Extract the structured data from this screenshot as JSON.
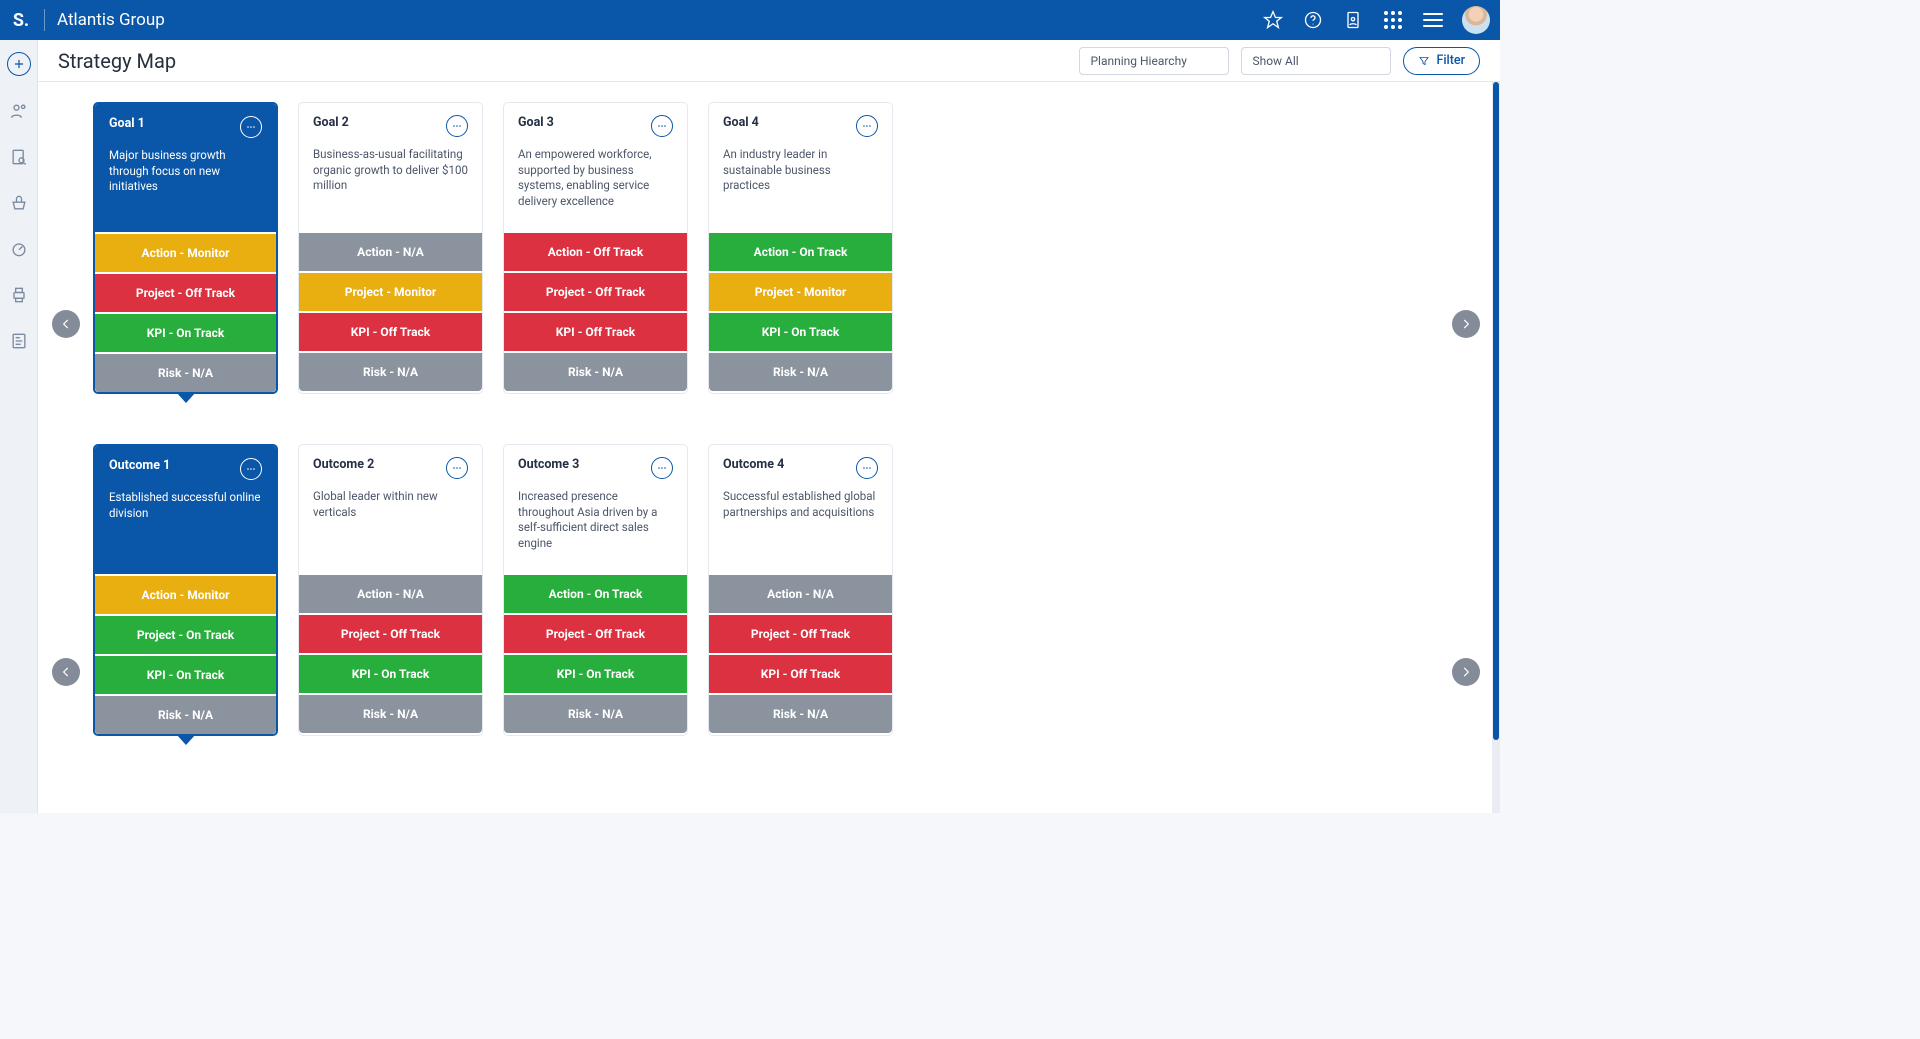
{
  "brand": {
    "logo": "S.",
    "name": "Atlantis Group"
  },
  "page": {
    "title": "Strategy Map"
  },
  "filters": {
    "planning_placeholder": "Planning Hiearchy",
    "show_placeholder": "Show All",
    "filter_label": "Filter"
  },
  "status_colors": {
    "na": "#8b939f",
    "off_track": "#db3140",
    "on_track": "#27ae3d",
    "monitor": "#e9ae10"
  },
  "rows": [
    {
      "key": "goals",
      "cards": [
        {
          "selected": true,
          "title": "Goal 1",
          "desc": "Major business growth through focus on new initiatives",
          "stats": [
            {
              "label": "Action - Monitor",
              "color": "yellow"
            },
            {
              "label": "Project - Off Track",
              "color": "red"
            },
            {
              "label": "KPI - On Track",
              "color": "green"
            },
            {
              "label": "Risk - N/A",
              "color": "gray"
            }
          ]
        },
        {
          "selected": false,
          "title": "Goal 2",
          "desc": "Business-as-usual facilitating organic growth to deliver $100 million",
          "stats": [
            {
              "label": "Action - N/A",
              "color": "gray"
            },
            {
              "label": "Project - Monitor",
              "color": "yellow"
            },
            {
              "label": "KPI - Off Track",
              "color": "red"
            },
            {
              "label": "Risk - N/A",
              "color": "gray"
            }
          ]
        },
        {
          "selected": false,
          "title": "Goal 3",
          "desc": "An empowered workforce, supported by business systems, enabling service delivery excellence",
          "stats": [
            {
              "label": "Action - Off Track",
              "color": "red"
            },
            {
              "label": "Project - Off Track",
              "color": "red"
            },
            {
              "label": "KPI - Off Track",
              "color": "red"
            },
            {
              "label": "Risk - N/A",
              "color": "gray"
            }
          ]
        },
        {
          "selected": false,
          "title": "Goal 4",
          "desc": "An industry leader in sustainable business practices",
          "stats": [
            {
              "label": "Action - On Track",
              "color": "green"
            },
            {
              "label": "Project - Monitor",
              "color": "yellow"
            },
            {
              "label": "KPI - On Track",
              "color": "green"
            },
            {
              "label": "Risk - N/A",
              "color": "gray"
            }
          ]
        }
      ]
    },
    {
      "key": "outcomes",
      "cards": [
        {
          "selected": true,
          "title": "Outcome 1",
          "desc": "Established successful online division",
          "stats": [
            {
              "label": "Action - Monitor",
              "color": "yellow"
            },
            {
              "label": "Project - On Track",
              "color": "green"
            },
            {
              "label": "KPI - On Track",
              "color": "green"
            },
            {
              "label": "Risk - N/A",
              "color": "gray"
            }
          ]
        },
        {
          "selected": false,
          "title": "Outcome 2",
          "desc": "Global leader within new verticals",
          "stats": [
            {
              "label": "Action - N/A",
              "color": "gray"
            },
            {
              "label": "Project - Off Track",
              "color": "red"
            },
            {
              "label": "KPI - On Track",
              "color": "green"
            },
            {
              "label": "Risk - N/A",
              "color": "gray"
            }
          ]
        },
        {
          "selected": false,
          "title": "Outcome 3",
          "desc": "Increased presence throughout Asia driven by a self-sufficient direct sales engine",
          "stats": [
            {
              "label": "Action - On Track",
              "color": "green"
            },
            {
              "label": "Project - Off Track",
              "color": "red"
            },
            {
              "label": "KPI - On Track",
              "color": "green"
            },
            {
              "label": "Risk - N/A",
              "color": "gray"
            }
          ]
        },
        {
          "selected": false,
          "title": "Outcome 4",
          "desc": "Successful established global partnerships and acquisitions",
          "stats": [
            {
              "label": "Action - N/A",
              "color": "gray"
            },
            {
              "label": "Project - Off Track",
              "color": "red"
            },
            {
              "label": "KPI - Off Track",
              "color": "red"
            },
            {
              "label": "Risk - N/A",
              "color": "gray"
            }
          ]
        }
      ]
    }
  ],
  "scrollbar": {
    "top_pct": 0,
    "height_pct": 90
  }
}
